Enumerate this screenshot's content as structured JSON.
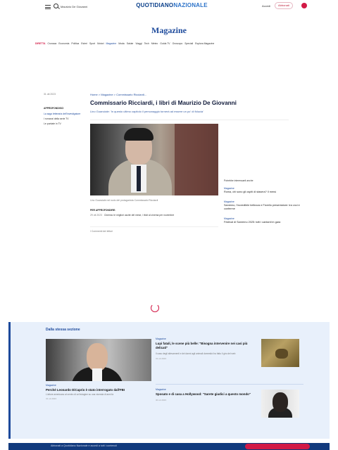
{
  "header": {
    "search_value": "Maurizio De Giovanni",
    "brand_part1": "QUOTIDIANO",
    "brand_part2": "NAZIONALE",
    "login": "Accedi",
    "subscribe": "Abbonati"
  },
  "section": {
    "title": "Magazine"
  },
  "nav": {
    "items": [
      "Cronaca",
      "Economia",
      "Politica",
      "Esteri",
      "Sport",
      "Motori",
      "Magazine",
      "Moda",
      "Salute",
      "Viaggi",
      "Tech",
      "Meteo",
      "Guida TV",
      "Oroscopo",
      "Speciali",
      "Esplora Magazine"
    ],
    "live": "DIRETTA",
    "active_index": 6
  },
  "article": {
    "date": "31 ott 2023",
    "left_tag": "APPROFONDISCI",
    "left_links": [
      "La saga letteraria dell'investigatore",
      "I romanzi della serie TV",
      "Le puntate in TV"
    ],
    "breadcrumb": "Home > Magazine > Commissario Ricciardi...",
    "headline": "Commissario Ricciardi, i libri di Maurizio De Giovanni",
    "subtitle": "Lino Guanciale: 'In questo ultimo capitolo il personaggio tornerà ad essere un po' di fiducia'",
    "caption": "Lino Guanciale nel ruolo del protagonista Commissario Ricciardi",
    "related_tag": "PER APPROFONDIRE:",
    "related_date": "29 ott 2023",
    "related_text": "Cinema: le migliori uscite del mese, i titoli al cinema per novembre",
    "comments": "I Commenti dei lettori"
  },
  "sidebar": {
    "head": "Potrebbe interessarti anche",
    "items": [
      {
        "cat": "Magazine",
        "title": "Roma, chi sono gli ospiti di stasera? Il menù"
      },
      {
        "cat": "Magazine",
        "title": "Sanremo, l'incredibile bellezza e Fiorello presentatore: tra voci e conferme"
      },
      {
        "cat": "Magazine",
        "title": "Festival di Sanremo 2025: tutti i cantanti in gara"
      }
    ]
  },
  "recommended": {
    "title": "Dalla stessa sezione",
    "big": {
      "cat": "Magazine",
      "title": "Perché Leonardo DiCaprio è stato interrogato dall'FBI",
      "desc": "L'attore americano al centro di un'indagine su una vicenda di anni fa",
      "date": "31 ott 2023"
    },
    "small": [
      {
        "cat": "Magazine",
        "title": "Lupi fatali, le scene più belle: \"Bisogna intervenire nei casi più delicati\"",
        "desc": "Il caso degli allevamenti e dei danni agli animali domestici ha fatto il giro del web",
        "date": "31 ott 2023"
      },
      {
        "cat": "Magazine",
        "title": "Sposato e di casa a Hollywood: \"Sarete giudici a questo mondo\"",
        "desc": "",
        "date": "30 ott 2023"
      }
    ]
  },
  "banner": {
    "text": "Abbonati a Quotidiano Nazionale e accedi a tutti i contenuti"
  },
  "colors": {
    "brand": "#0a3f8a",
    "accent": "#d21a46",
    "link": "#1d4a9c"
  }
}
